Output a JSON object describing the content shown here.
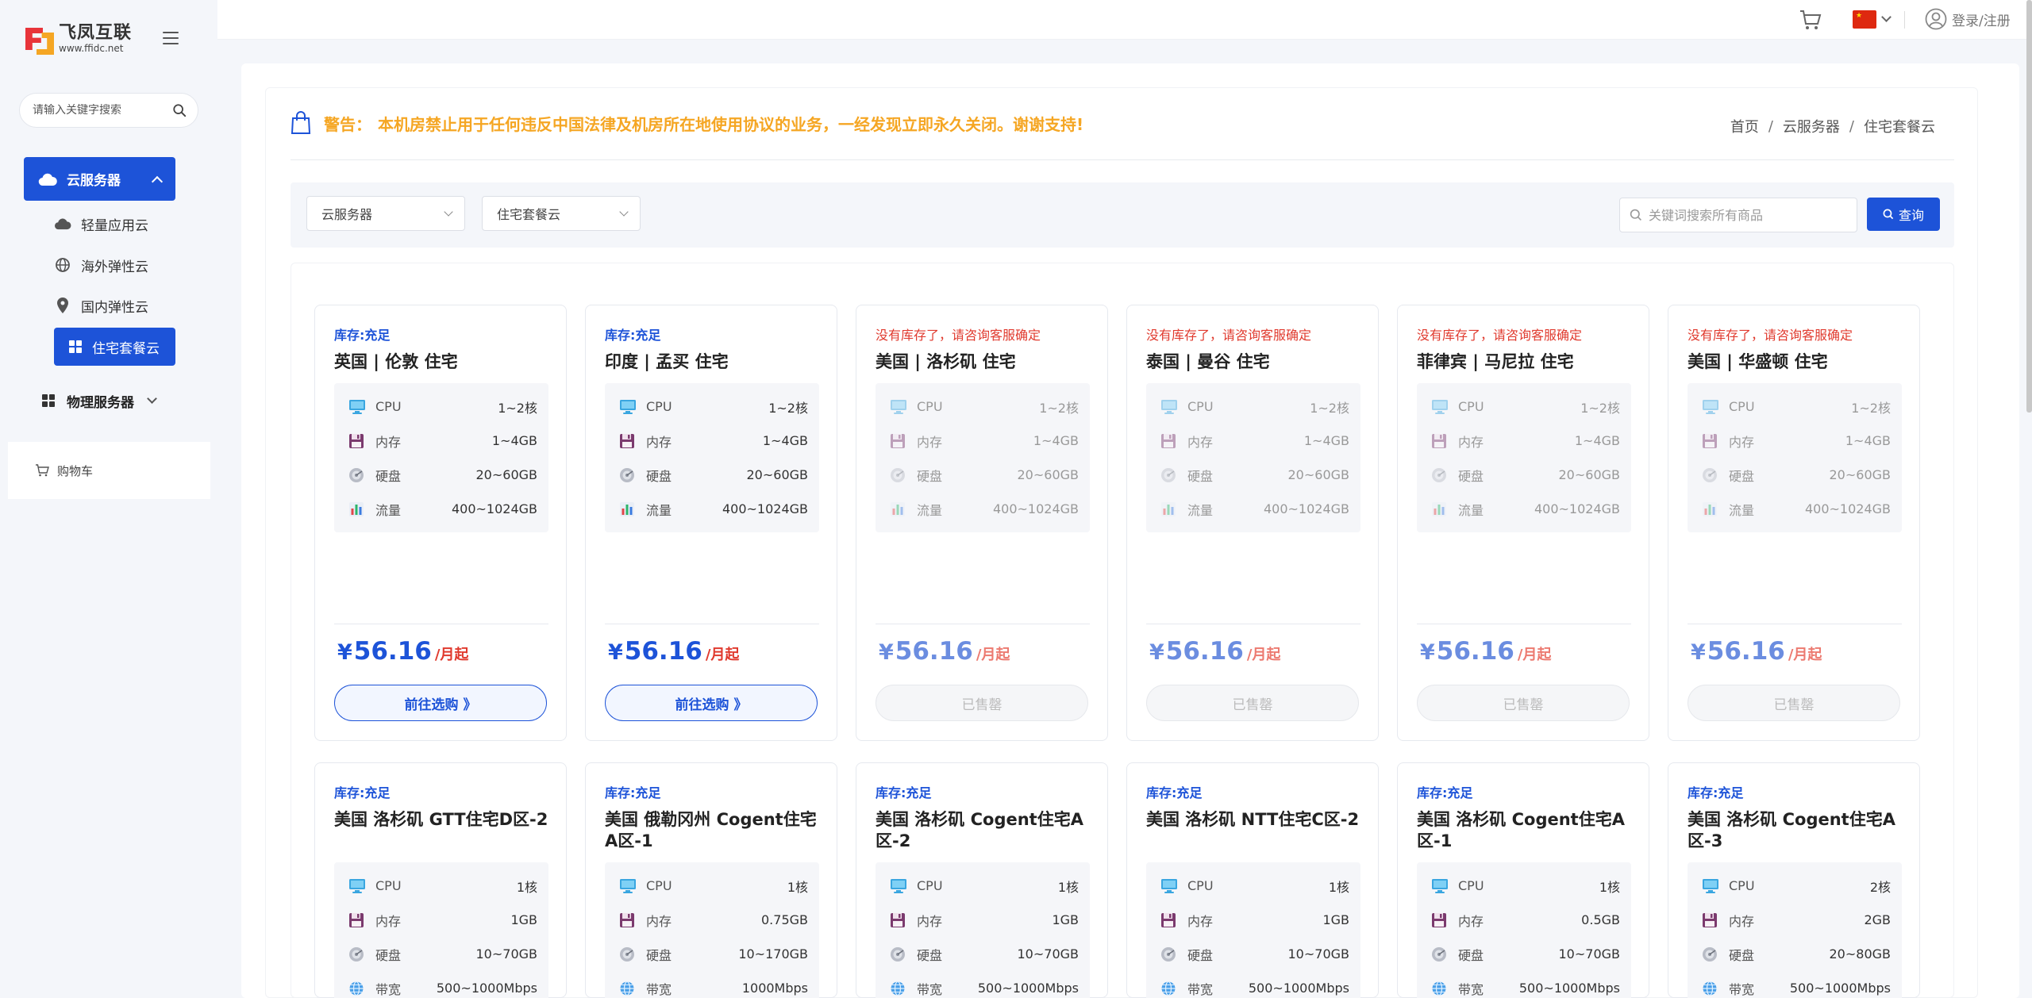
{
  "brand": {
    "name": "飞凤互联",
    "url": "www.ffidc.net"
  },
  "sidebar": {
    "search_placeholder": "请输入关键字搜索",
    "cloud_label": "云服务器",
    "sub_items": [
      "轻量应用云",
      "海外弹性云",
      "国内弹性云"
    ],
    "active_sub": "住宅套餐云",
    "physical_label": "物理服务器",
    "cart_label": "购物车"
  },
  "topbar": {
    "login_label": "登录/注册"
  },
  "notice": {
    "label": "警告：",
    "text": "本机房禁止用于任何违反中国法律及机房所在地使用协议的业务，一经发现立即永久关闭。谢谢支持!"
  },
  "breadcrumb": {
    "home": "首页",
    "section": "云服务器",
    "current": "住宅套餐云",
    "sep": "/"
  },
  "filters": {
    "category": "云服务器",
    "subcategory": "住宅套餐云",
    "search_placeholder": "关键词搜索所有商品",
    "query_label": "查询"
  },
  "labels": {
    "cpu": "CPU",
    "memory": "内存",
    "disk": "硬盘",
    "traffic": "流量",
    "bandwidth": "带宽",
    "currency": "¥",
    "price_unit": "/月起",
    "buy_label": "前往选购 》",
    "sold_label": "已售罄",
    "stock_ok": "库存:充足",
    "stock_no": "没有库存了，请咨询客服确定"
  },
  "row1": [
    {
      "name": "英国 | 伦敦 住宅",
      "cpu": "1~2核",
      "memory": "1~4GB",
      "disk": "20~60GB",
      "traffic": "400~1024GB",
      "price": "56.16",
      "in_stock": true
    },
    {
      "name": "印度 | 孟买 住宅",
      "cpu": "1~2核",
      "memory": "1~4GB",
      "disk": "20~60GB",
      "traffic": "400~1024GB",
      "price": "56.16",
      "in_stock": true
    },
    {
      "name": "美国 | 洛杉矶 住宅",
      "cpu": "1~2核",
      "memory": "1~4GB",
      "disk": "20~60GB",
      "traffic": "400~1024GB",
      "price": "56.16",
      "in_stock": false
    },
    {
      "name": "泰国 | 曼谷 住宅",
      "cpu": "1~2核",
      "memory": "1~4GB",
      "disk": "20~60GB",
      "traffic": "400~1024GB",
      "price": "56.16",
      "in_stock": false
    },
    {
      "name": "菲律宾 | 马尼拉 住宅",
      "cpu": "1~2核",
      "memory": "1~4GB",
      "disk": "20~60GB",
      "traffic": "400~1024GB",
      "price": "56.16",
      "in_stock": false
    },
    {
      "name": "美国 | 华盛顿 住宅",
      "cpu": "1~2核",
      "memory": "1~4GB",
      "disk": "20~60GB",
      "traffic": "400~1024GB",
      "price": "56.16",
      "in_stock": false
    }
  ],
  "row2": [
    {
      "name": "美国 洛杉矶 GTT住宅D区-2",
      "cpu": "1核",
      "memory": "1GB",
      "disk": "10~70GB",
      "bandwidth": "500~1000Mbps",
      "in_stock": true
    },
    {
      "name": "美国 俄勒冈州 Cogent住宅A区-1",
      "cpu": "1核",
      "memory": "0.75GB",
      "disk": "10~170GB",
      "bandwidth": "1000Mbps",
      "in_stock": true
    },
    {
      "name": "美国 洛杉矶 Cogent住宅A区-2",
      "cpu": "1核",
      "memory": "1GB",
      "disk": "10~70GB",
      "bandwidth": "500~1000Mbps",
      "in_stock": true
    },
    {
      "name": "美国 洛杉矶 NTT住宅C区-2",
      "cpu": "1核",
      "memory": "1GB",
      "disk": "10~70GB",
      "bandwidth": "500~1000Mbps",
      "in_stock": true
    },
    {
      "name": "美国 洛杉矶 Cogent住宅A区-1",
      "cpu": "1核",
      "memory": "0.5GB",
      "disk": "10~70GB",
      "bandwidth": "500~1000Mbps",
      "in_stock": true
    },
    {
      "name": "美国 洛杉矶 Cogent住宅A区-3",
      "cpu": "2核",
      "memory": "2GB",
      "disk": "20~80GB",
      "bandwidth": "500~1000Mbps",
      "in_stock": true
    }
  ]
}
